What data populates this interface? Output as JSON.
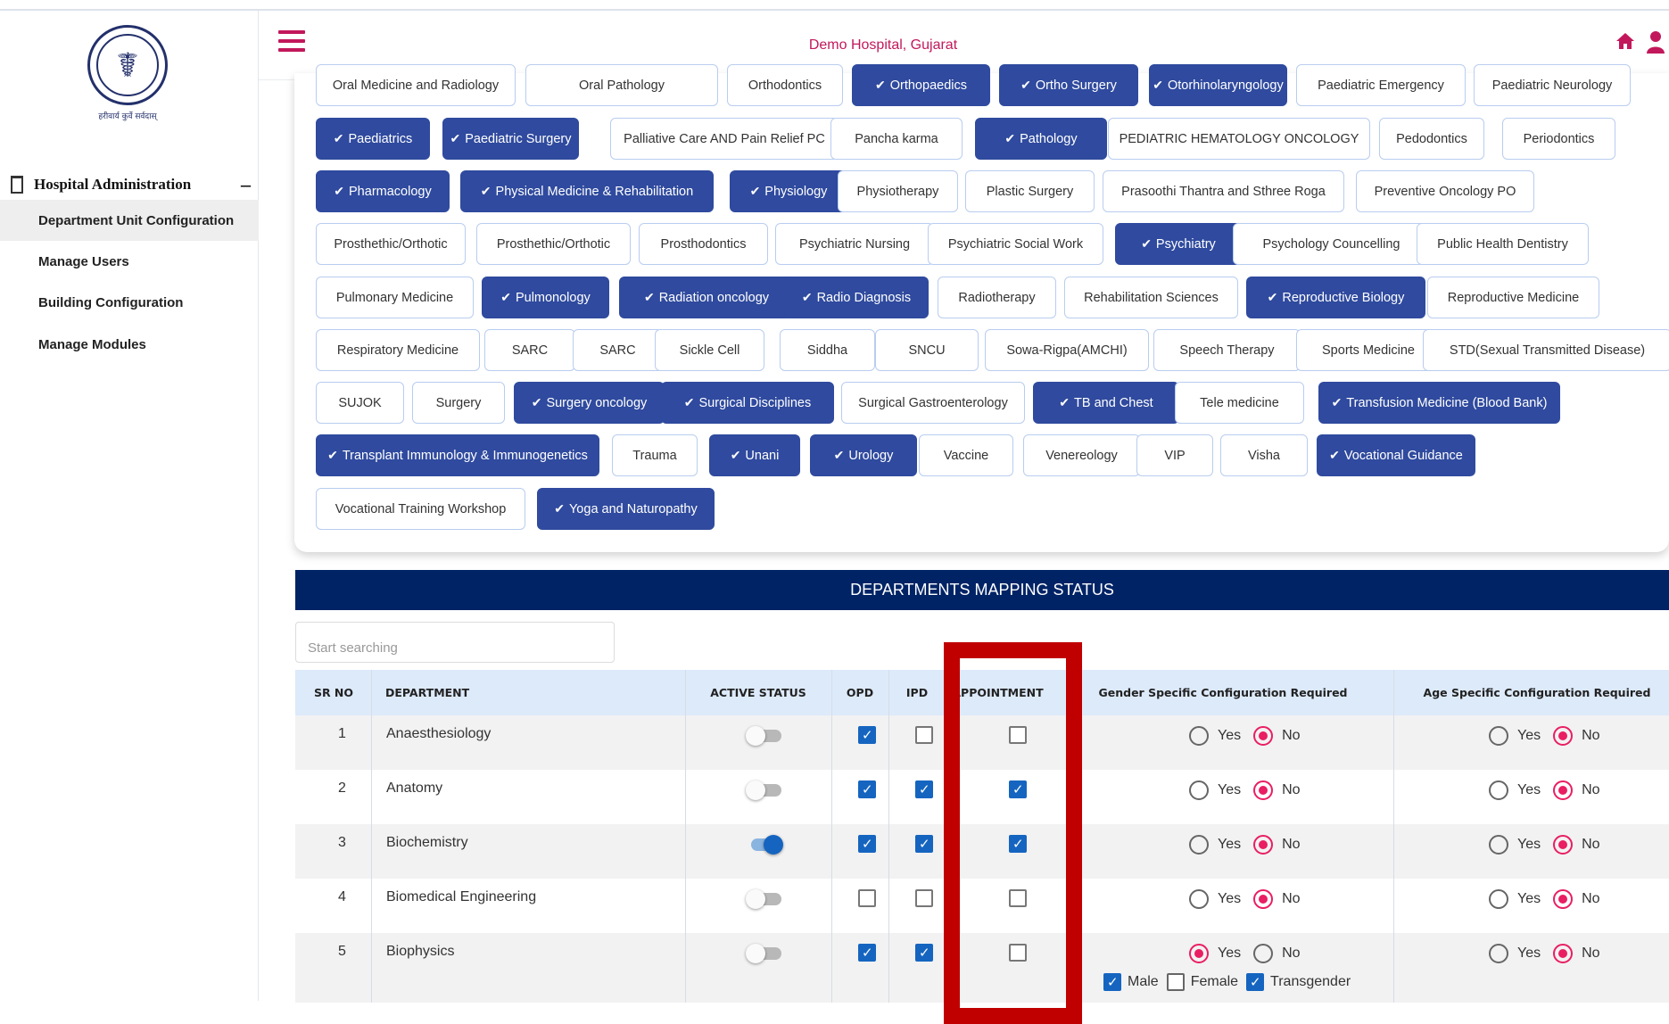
{
  "sidebar": {
    "logo_caption": "हरीवार्य कुर्वे सर्वदास्",
    "section_title": "Hospital Administration",
    "items": [
      {
        "label": "Department Unit Configuration"
      },
      {
        "label": "Manage Users"
      },
      {
        "label": "Building Configuration"
      },
      {
        "label": "Manage Modules"
      }
    ]
  },
  "header": {
    "title": "Demo Hospital, Gujarat"
  },
  "departments": [
    {
      "label": "Oral Medicine and Radiology",
      "selected": false
    },
    {
      "label": "Oral Pathology",
      "selected": false
    },
    {
      "label": "Orthodontics",
      "selected": false
    },
    {
      "label": "Orthopaedics",
      "selected": true
    },
    {
      "label": "Ortho Surgery",
      "selected": true
    },
    {
      "label": "Otorhinolaryngology",
      "selected": true
    },
    {
      "label": "Paediatric Emergency",
      "selected": false
    },
    {
      "label": "Paediatric Neurology",
      "selected": false
    },
    {
      "label": "Paediatrics",
      "selected": true
    },
    {
      "label": "Paediatric Surgery",
      "selected": true
    },
    {
      "label": "Palliative Care AND Pain Relief PC",
      "selected": false
    },
    {
      "label": "Pancha karma",
      "selected": false
    },
    {
      "label": "Pathology",
      "selected": true
    },
    {
      "label": "PEDIATRIC HEMATOLOGY ONCOLOGY",
      "selected": false
    },
    {
      "label": "Pedodontics",
      "selected": false
    },
    {
      "label": "Periodontics",
      "selected": false
    },
    {
      "label": "Pharmacology",
      "selected": true
    },
    {
      "label": "Physical Medicine & Rehabilitation",
      "selected": true
    },
    {
      "label": "Physiology",
      "selected": true
    },
    {
      "label": "Physiotherapy",
      "selected": false
    },
    {
      "label": "Plastic Surgery",
      "selected": false
    },
    {
      "label": "Prasoothi Thantra and Sthree Roga",
      "selected": false
    },
    {
      "label": "Preventive Oncology PO",
      "selected": false
    },
    {
      "label": "Prosthethic/Orthotic",
      "selected": false
    },
    {
      "label": "Prosthethic/Orthotic",
      "selected": false
    },
    {
      "label": "Prosthodontics",
      "selected": false
    },
    {
      "label": "Psychiatric Nursing",
      "selected": false
    },
    {
      "label": "Psychiatric Social Work",
      "selected": false
    },
    {
      "label": "Psychiatry",
      "selected": true
    },
    {
      "label": "Psychology Councelling",
      "selected": false
    },
    {
      "label": "Public Health Dentistry",
      "selected": false
    },
    {
      "label": "Pulmonary Medicine",
      "selected": false
    },
    {
      "label": "Pulmonology",
      "selected": true
    },
    {
      "label": "Radiation oncology",
      "selected": true
    },
    {
      "label": "Radio Diagnosis",
      "selected": true
    },
    {
      "label": "Radiotherapy",
      "selected": false
    },
    {
      "label": "Rehabilitation Sciences",
      "selected": false
    },
    {
      "label": "Reproductive Biology",
      "selected": true
    },
    {
      "label": "Reproductive Medicine",
      "selected": false
    },
    {
      "label": "Respiratory Medicine",
      "selected": false
    },
    {
      "label": "SARC",
      "selected": false
    },
    {
      "label": "SARC",
      "selected": false
    },
    {
      "label": "Sickle Cell",
      "selected": false
    },
    {
      "label": "Siddha",
      "selected": false
    },
    {
      "label": "SNCU",
      "selected": false
    },
    {
      "label": "Sowa-Rigpa(AMCHI)",
      "selected": false
    },
    {
      "label": "Speech Therapy",
      "selected": false
    },
    {
      "label": "Sports Medicine",
      "selected": false
    },
    {
      "label": "STD(Sexual Transmitted Disease)",
      "selected": false
    },
    {
      "label": "SUJOK",
      "selected": false
    },
    {
      "label": "Surgery",
      "selected": false
    },
    {
      "label": "Surgery oncology",
      "selected": true
    },
    {
      "label": "Surgical Disciplines",
      "selected": true
    },
    {
      "label": "Surgical Gastroenterology",
      "selected": false
    },
    {
      "label": "TB and Chest",
      "selected": true
    },
    {
      "label": "Tele medicine",
      "selected": false
    },
    {
      "label": "Transfusion Medicine (Blood Bank)",
      "selected": true
    },
    {
      "label": "Transplant Immunology & Immunogenetics",
      "selected": true
    },
    {
      "label": "Trauma",
      "selected": false
    },
    {
      "label": "Unani",
      "selected": true
    },
    {
      "label": "Urology",
      "selected": true
    },
    {
      "label": "Vaccine",
      "selected": false
    },
    {
      "label": "Venereology",
      "selected": false
    },
    {
      "label": "VIP",
      "selected": false
    },
    {
      "label": "Visha",
      "selected": false
    },
    {
      "label": "Vocational Guidance",
      "selected": true
    },
    {
      "label": "Vocational Training Workshop",
      "selected": false
    },
    {
      "label": "Yoga and Naturopathy",
      "selected": true
    }
  ],
  "mapping": {
    "title": "DEPARTMENTS MAPPING STATUS",
    "search_placeholder": "Start searching",
    "columns": {
      "sr": "SR NO",
      "department": "DEPARTMENT",
      "active": "ACTIVE STATUS",
      "opd": "OPD",
      "ipd": "IPD",
      "appointment": "APPOINTMENT",
      "gender": "Gender Specific Configuration Required",
      "age": "Age Specific Configuration Required"
    },
    "yes_label": "Yes",
    "no_label": "No",
    "gender_options": [
      "Male",
      "Female",
      "Transgender"
    ],
    "rows": [
      {
        "sr": "1",
        "department": "Anaesthesiology",
        "active": false,
        "opd": true,
        "ipd": false,
        "appointment": false,
        "gender_specific": false,
        "age_specific": false
      },
      {
        "sr": "2",
        "department": "Anatomy",
        "active": false,
        "opd": true,
        "ipd": true,
        "appointment": true,
        "gender_specific": false,
        "age_specific": false
      },
      {
        "sr": "3",
        "department": "Biochemistry",
        "active": true,
        "opd": true,
        "ipd": true,
        "appointment": true,
        "gender_specific": false,
        "age_specific": false
      },
      {
        "sr": "4",
        "department": "Biomedical Engineering",
        "active": false,
        "opd": false,
        "ipd": false,
        "appointment": false,
        "gender_specific": false,
        "age_specific": false
      },
      {
        "sr": "5",
        "department": "Biophysics",
        "active": false,
        "opd": true,
        "ipd": true,
        "appointment": false,
        "gender_specific": true,
        "age_specific": false,
        "genders": {
          "Male": true,
          "Female": false,
          "Transgender": true
        }
      }
    ]
  },
  "colors": {
    "brand_pink": "#c2185b",
    "selected_chip": "#2f4a9e",
    "mapping_bar": "#002366",
    "radio_on": "#e91e63",
    "checkbox_on": "#1565c0",
    "highlight_box": "#c00000"
  }
}
